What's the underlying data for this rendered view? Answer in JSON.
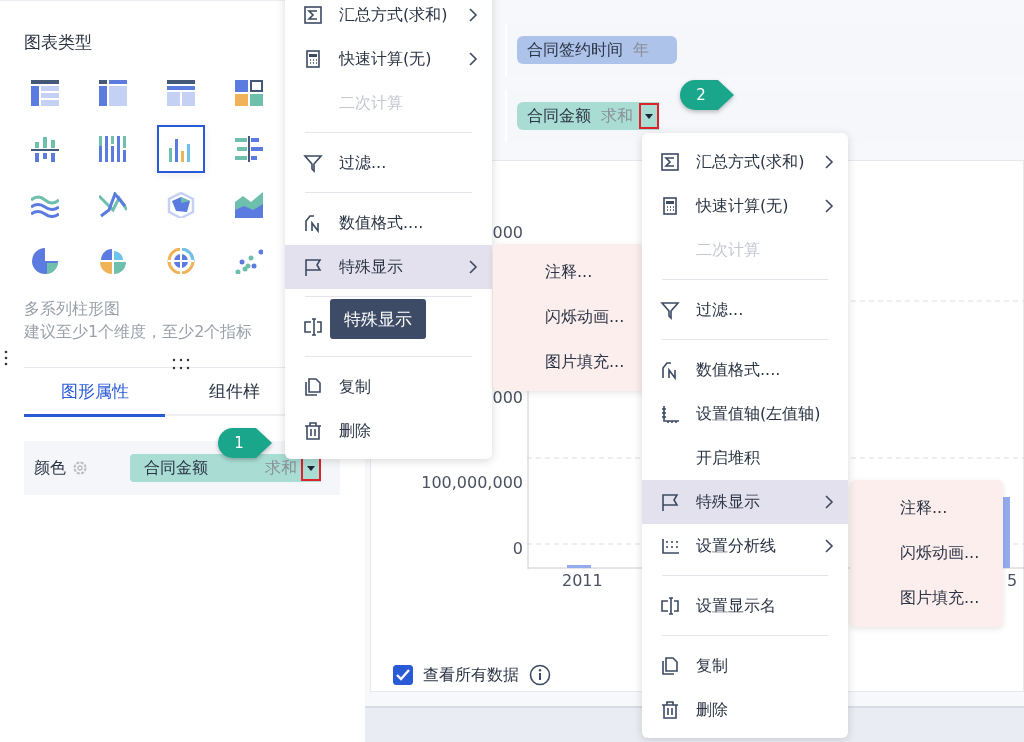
{
  "left_panel": {
    "title": "图表类型",
    "chart_types": [
      {
        "selected": false
      },
      {
        "selected": false
      },
      {
        "selected": false
      },
      {
        "selected": false
      },
      {
        "selected": false
      },
      {
        "selected": false
      },
      {
        "selected": true
      },
      {
        "selected": false
      },
      {
        "selected": false
      },
      {
        "selected": false
      },
      {
        "selected": false
      },
      {
        "selected": false
      },
      {
        "selected": false
      },
      {
        "selected": false
      },
      {
        "selected": false
      },
      {
        "selected": false
      }
    ],
    "chart_name": "多系列柱形图",
    "chart_hint": "建议至少1个维度，至少2个指标",
    "tabs": [
      {
        "label": "图形属性",
        "selected": true
      },
      {
        "label": "组件样",
        "selected": false
      }
    ],
    "color_field": {
      "label": "颜色",
      "pill": {
        "name": "合同金额",
        "aggregation": "求和"
      },
      "callout": "1"
    }
  },
  "right_panel": {
    "column_pill": {
      "name": "合同签约时间",
      "aggregation": "年"
    },
    "value_pill": {
      "name": "合同金额",
      "aggregation": "求和"
    },
    "callout": "2",
    "chart": {
      "y_labels": [
        "000",
        "000",
        "100,000,000",
        "0"
      ],
      "x_labels": [
        "2011",
        "5"
      ]
    },
    "show_all_data": {
      "label": "查看所有数据",
      "checked": true
    }
  },
  "menus": [
    {
      "items": [
        {
          "kind": "command",
          "label": "汇总方式(求和)",
          "has_submenu": true,
          "disabled": false,
          "selected": false
        },
        {
          "kind": "command",
          "label": "快速计算(无)",
          "has_submenu": true,
          "disabled": false,
          "selected": false
        },
        {
          "kind": "command",
          "label": "二次计算",
          "has_submenu": false,
          "disabled": true,
          "selected": false
        },
        {
          "kind": "divider"
        },
        {
          "kind": "command",
          "label": "过滤...",
          "has_submenu": false,
          "disabled": false,
          "selected": false
        },
        {
          "kind": "divider"
        },
        {
          "kind": "command",
          "label": "数值格式....",
          "has_submenu": false,
          "disabled": false,
          "selected": false
        },
        {
          "kind": "command",
          "label": "特殊显示",
          "has_submenu": true,
          "disabled": false,
          "selected": true
        },
        {
          "kind": "divider"
        },
        {
          "kind": "command",
          "has_submenu": false,
          "disabled": false,
          "selected": false
        },
        {
          "kind": "divider"
        },
        {
          "kind": "command",
          "label": "复制",
          "has_submenu": false,
          "disabled": false,
          "selected": false
        },
        {
          "kind": "command",
          "label": "删除",
          "has_submenu": false,
          "disabled": false,
          "selected": false
        }
      ]
    },
    {
      "items": [
        {
          "kind": "command",
          "label": "汇总方式(求和)",
          "has_submenu": true,
          "disabled": false,
          "selected": false
        },
        {
          "kind": "command",
          "label": "快速计算(无)",
          "has_submenu": true,
          "disabled": false,
          "selected": false
        },
        {
          "kind": "command",
          "label": "二次计算",
          "has_submenu": false,
          "disabled": true,
          "selected": false
        },
        {
          "kind": "divider"
        },
        {
          "kind": "command",
          "label": "过滤...",
          "has_submenu": false,
          "disabled": false,
          "selected": false
        },
        {
          "kind": "divider"
        },
        {
          "kind": "command",
          "label": "数值格式....",
          "has_submenu": false,
          "disabled": false,
          "selected": false
        },
        {
          "kind": "command",
          "label": "设置值轴(左值轴)",
          "has_submenu": false,
          "disabled": false,
          "selected": false
        },
        {
          "kind": "command",
          "label": "开启堆积",
          "has_submenu": false,
          "disabled": false,
          "selected": false
        },
        {
          "kind": "command",
          "label": "特殊显示",
          "has_submenu": true,
          "disabled": false,
          "selected": true
        },
        {
          "kind": "command",
          "label": "设置分析线",
          "has_submenu": true,
          "disabled": false,
          "selected": false
        },
        {
          "kind": "divider"
        },
        {
          "kind": "command",
          "label": "设置显示名",
          "has_submenu": false,
          "disabled": false,
          "selected": false
        },
        {
          "kind": "divider"
        },
        {
          "kind": "command",
          "label": "复制",
          "has_submenu": false,
          "disabled": false,
          "selected": false
        },
        {
          "kind": "command",
          "label": "删除",
          "has_submenu": false,
          "disabled": false,
          "selected": false
        }
      ]
    }
  ],
  "submenus": [
    {
      "items": [
        "注释...",
        "闪烁动画...",
        "图片填充..."
      ]
    },
    {
      "items": [
        "注释...",
        "闪烁动画...",
        "图片填充..."
      ]
    }
  ],
  "tooltip": "特殊显示"
}
